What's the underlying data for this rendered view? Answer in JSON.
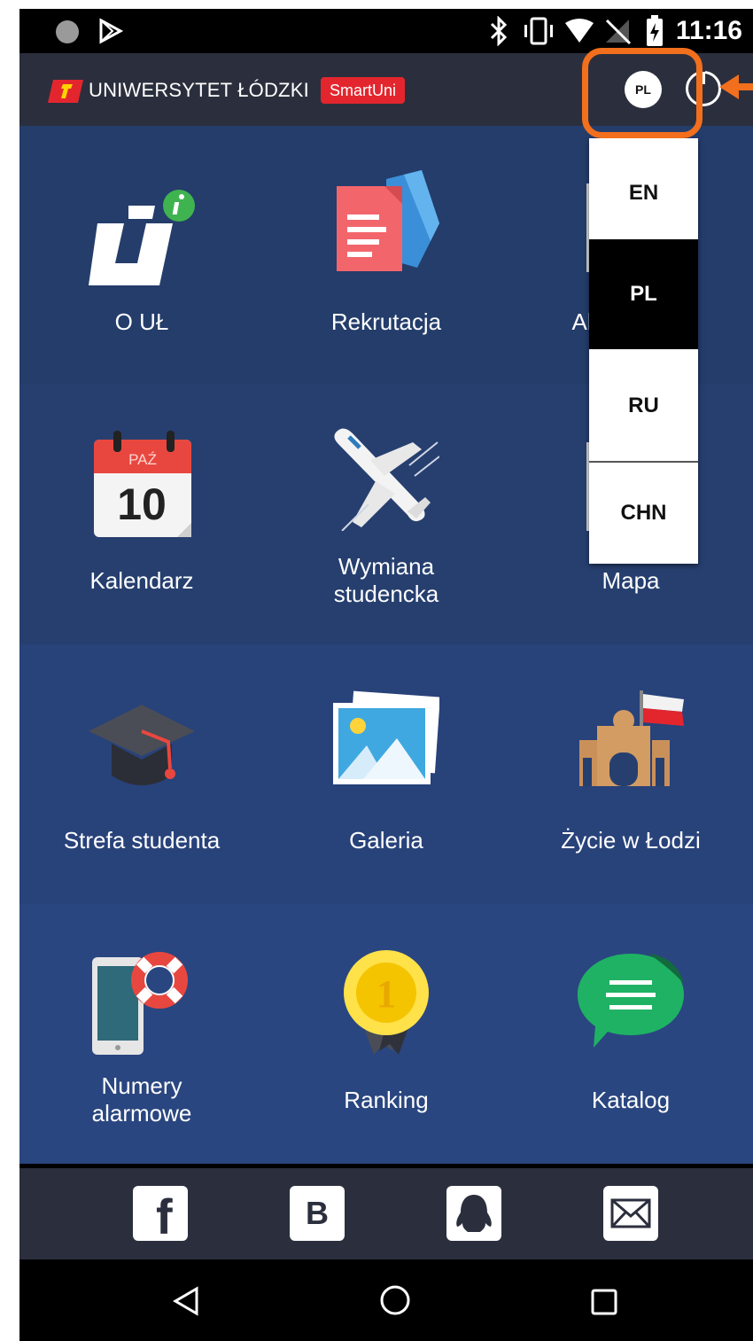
{
  "status_bar": {
    "time": "11:16"
  },
  "header": {
    "brand": "UNIWERSYTET ŁÓDZKI",
    "badge": "SmartUni",
    "language_button": "PL"
  },
  "grid": [
    {
      "label": "O UŁ",
      "icon": "ul-info-icon"
    },
    {
      "label": "Rekrutacja",
      "icon": "documents-icon"
    },
    {
      "label": "Aktualności",
      "icon": "news-icon"
    },
    {
      "label": "Kalendarz",
      "icon": "calendar-icon",
      "calendar_month": "PAŹ",
      "calendar_day": "10"
    },
    {
      "label_line1": "Wymiana",
      "label_line2": "studencka",
      "icon": "airplane-icon"
    },
    {
      "label": "Mapa",
      "icon": "map-icon"
    },
    {
      "label": "Strefa studenta",
      "icon": "graduation-cap-icon"
    },
    {
      "label": "Galeria",
      "icon": "photos-icon"
    },
    {
      "label": "Życie w Łodzi",
      "icon": "city-gate-icon"
    },
    {
      "label_line1": "Numery",
      "label_line2": "alarmowe",
      "icon": "lifebuoy-phone-icon"
    },
    {
      "label": "Ranking",
      "icon": "medal-icon",
      "medal_number": "1"
    },
    {
      "label": "Katalog",
      "icon": "chat-bubble-icon"
    }
  ],
  "language_menu": {
    "items": [
      "EN",
      "PL",
      "RU",
      "CHN"
    ],
    "selected": "PL"
  },
  "social": {
    "facebook": "f",
    "vk": "B"
  },
  "colors": {
    "highlight": "#f26f1d",
    "brand_red": "#e3262e",
    "header_bg": "#2b2f3d",
    "grid_bg": "#263f6f"
  }
}
